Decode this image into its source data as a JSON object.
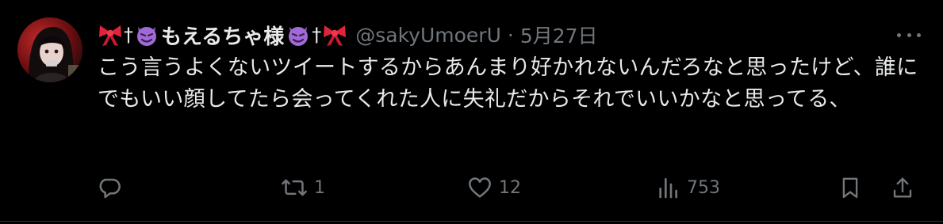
{
  "tweet": {
    "display_name": "もえるちゃ様",
    "handle": "@sakyUmoerU",
    "separator": "·",
    "date": "5月27日",
    "text": "こう言うよくないツイートするからあんまり好かれないんだろなと思ったけど、誰にでもいい顔してたら会ってくれた人に失礼だからそれでいいかなと思ってる、",
    "name_decorations": {
      "ribbon": "ribbon-emoji",
      "cross": "†",
      "devil": "smiling-imp-emoji"
    }
  },
  "actions": {
    "reply": {
      "icon": "reply-icon",
      "count": ""
    },
    "retweet": {
      "icon": "retweet-icon",
      "count": "1"
    },
    "like": {
      "icon": "heart-icon",
      "count": "12"
    },
    "views": {
      "icon": "views-icon",
      "count": "753"
    },
    "bookmark": {
      "icon": "bookmark-icon"
    },
    "share": {
      "icon": "share-icon"
    }
  },
  "colors": {
    "background": "#000000",
    "text_primary": "#e7e9ea",
    "text_secondary": "#71767b",
    "divider": "#2f3336"
  }
}
